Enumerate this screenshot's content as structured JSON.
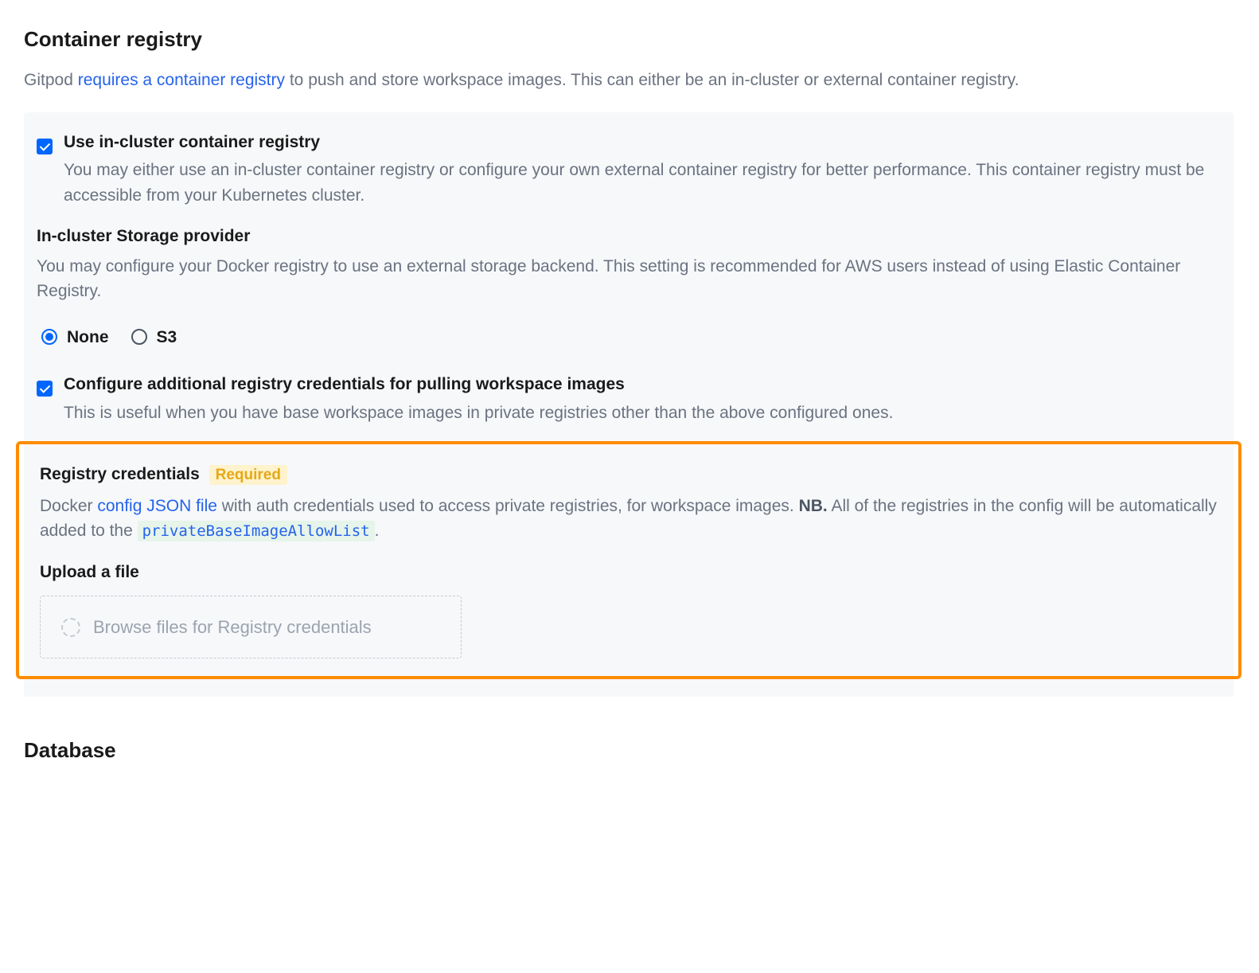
{
  "sections": {
    "container_registry": {
      "title": "Container registry",
      "intro_prefix": "Gitpod ",
      "intro_link": "requires a container registry",
      "intro_suffix": " to push and store workspace images. This can either be an in-cluster or external container registry."
    },
    "database": {
      "title": "Database"
    }
  },
  "use_in_cluster": {
    "label": "Use in-cluster container registry",
    "desc": "You may either use an in-cluster container registry or configure your own external container registry for better performance. This container registry must be accessible from your Kubernetes cluster."
  },
  "storage_provider": {
    "label": "In-cluster Storage provider",
    "desc": "You may configure your Docker registry to use an external storage backend. This setting is recommended for AWS users instead of using Elastic Container Registry.",
    "options": {
      "none": "None",
      "s3": "S3"
    }
  },
  "additional_creds": {
    "label": "Configure additional registry credentials for pulling workspace images",
    "desc": "This is useful when you have base workspace images in private registries other than the above configured ones."
  },
  "registry_creds": {
    "title": "Registry credentials",
    "badge": "Required",
    "desc_prefix": "Docker ",
    "desc_link": "config JSON file",
    "desc_middle": " with auth credentials used to access private registries, for workspace images. ",
    "nb": "NB.",
    "desc_suffix": " All of the registries in the config will be automatically added to the ",
    "code": "privateBaseImageAllowList",
    "period": ".",
    "upload_label": "Upload a file",
    "upload_text": "Browse files for Registry credentials"
  }
}
